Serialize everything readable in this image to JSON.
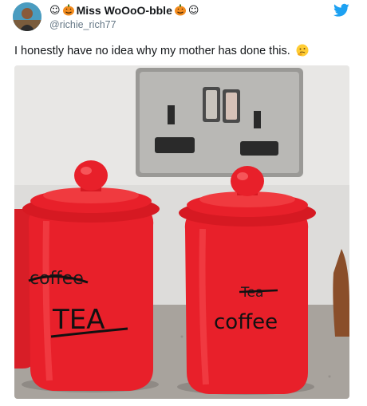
{
  "author": {
    "display_name": "Miss WoOoO-bble",
    "handle": "@richie_rich77",
    "name_prefix_icons": [
      "ghost-icon",
      "pumpkin-icon"
    ],
    "name_suffix_icons": [
      "pumpkin-icon",
      "ghost-icon"
    ]
  },
  "tweet": {
    "text": "I honestly have no idea why my mother has done this.",
    "trailing_emoji": "thinking-face"
  },
  "photo": {
    "left_jar": {
      "crossed_word": "coffee",
      "written_word": "TEA"
    },
    "right_jar": {
      "crossed_word": "Tea",
      "written_word": "coffee"
    }
  },
  "colors": {
    "twitter_blue": "#1da1f2",
    "jar_red": "#e8202a",
    "handle_grey": "#657786"
  }
}
